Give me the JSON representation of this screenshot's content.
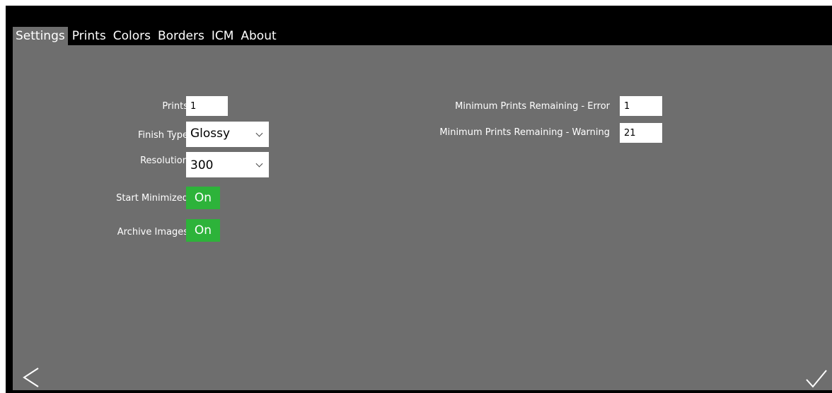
{
  "tabs": [
    {
      "label": "Settings",
      "active": true
    },
    {
      "label": "Prints",
      "active": false
    },
    {
      "label": "Colors",
      "active": false
    },
    {
      "label": "Borders",
      "active": false
    },
    {
      "label": "ICM",
      "active": false
    },
    {
      "label": "About",
      "active": false
    }
  ],
  "settings": {
    "prints": {
      "label": "Prints",
      "value": "1"
    },
    "finish_type": {
      "label": "Finish Type",
      "value": "Glossy"
    },
    "resolution": {
      "label": "Resolution",
      "value": "300"
    },
    "start_minimized": {
      "label": "Start Minimized",
      "value": "On"
    },
    "archive_images": {
      "label": "Archive Images",
      "value": "On"
    },
    "min_prints_error": {
      "label": "Minimum Prints Remaining - Error",
      "value": "1"
    },
    "min_prints_warning": {
      "label": "Minimum Prints Remaining - Warning",
      "value": "21"
    }
  },
  "nav": {
    "back_icon": "chevron-left-icon",
    "confirm_icon": "checkmark-icon"
  },
  "colors": {
    "panel": "#6e6e6e",
    "background": "#000000",
    "toggle_on": "#2db33a"
  }
}
